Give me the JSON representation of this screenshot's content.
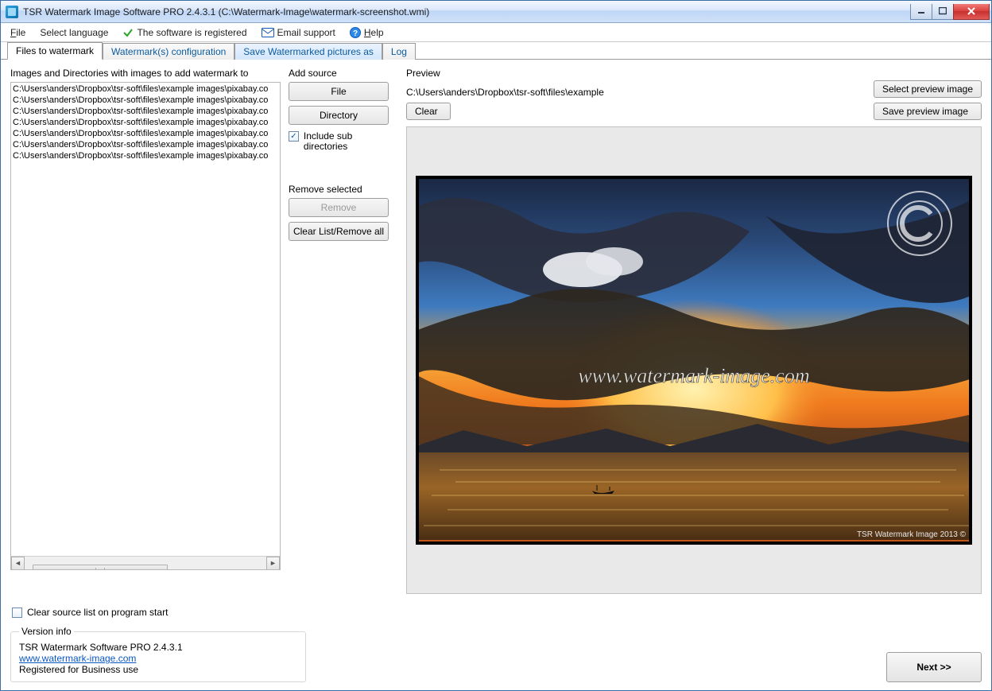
{
  "titlebar": {
    "title": "TSR Watermark Image Software PRO 2.4.3.1 (C:\\Watermark-Image\\watermark-screenshot.wmi)"
  },
  "menubar": {
    "file": "File",
    "select_language": "Select language",
    "registered": "The software is registered",
    "email_support": "Email support",
    "help": "Help"
  },
  "tabs": {
    "files": "Files to watermark",
    "config": "Watermark(s) configuration",
    "save_as": "Save Watermarked pictures as",
    "log": "Log"
  },
  "left": {
    "label": "Images and Directories with images to add watermark to",
    "items": [
      "C:\\Users\\anders\\Dropbox\\tsr-soft\\files\\example images\\pixabay.co",
      "C:\\Users\\anders\\Dropbox\\tsr-soft\\files\\example images\\pixabay.co",
      "C:\\Users\\anders\\Dropbox\\tsr-soft\\files\\example images\\pixabay.co",
      "C:\\Users\\anders\\Dropbox\\tsr-soft\\files\\example images\\pixabay.co",
      "C:\\Users\\anders\\Dropbox\\tsr-soft\\files\\example images\\pixabay.co",
      "C:\\Users\\anders\\Dropbox\\tsr-soft\\files\\example images\\pixabay.co",
      "C:\\Users\\anders\\Dropbox\\tsr-soft\\files\\example images\\pixabay.co"
    ],
    "clear_on_start": "Clear source list on program start"
  },
  "add_source": {
    "label": "Add source",
    "file_btn": "File",
    "dir_btn": "Directory",
    "include_sub": "Include sub directories"
  },
  "remove": {
    "label": "Remove selected",
    "remove_btn": "Remove",
    "clear_btn": "Clear List/Remove all"
  },
  "preview": {
    "label": "Preview",
    "path": "C:\\Users\\anders\\Dropbox\\tsr-soft\\files\\example",
    "clear_btn": "Clear",
    "select_btn": "Select preview image",
    "save_btn": "Save preview image",
    "watermark_text": "www.watermark-image.com",
    "copyright_text": "TSR Watermark Image 2013 ©"
  },
  "version": {
    "label": "Version info",
    "line1": "TSR Watermark Software PRO 2.4.3.1",
    "link": "www.watermark-image.com",
    "line3": "Registered for Business use"
  },
  "next_btn": "Next >>"
}
